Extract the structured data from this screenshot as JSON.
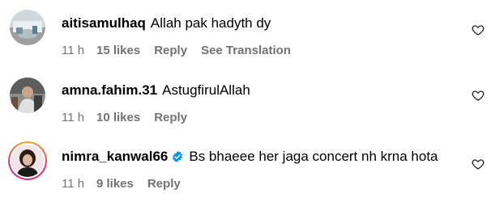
{
  "comments": [
    {
      "username": "aitisamulhaq",
      "text": "Allah pak hadyth dy",
      "time": "11 h",
      "likes": "15 likes",
      "reply": "Reply",
      "translate": "See Translation",
      "verified": false
    },
    {
      "username": "amna.fahim.31",
      "text": "AstugfirulAllah",
      "time": "11 h",
      "likes": "10 likes",
      "reply": "Reply",
      "verified": false
    },
    {
      "username": "nimra_kanwal66",
      "text": "Bs bhaeee her jaga concert nh krna hota",
      "time": "11 h",
      "likes": "9 likes",
      "reply": "Reply",
      "verified": true
    }
  ],
  "icons": {
    "like": "heart-outline-icon",
    "verified": "verified-badge-icon"
  },
  "colors": {
    "meta_text": "#737373",
    "verified_blue": "#0095f6",
    "story_ring_start": "#f9a825",
    "story_ring_end": "#c13584"
  }
}
